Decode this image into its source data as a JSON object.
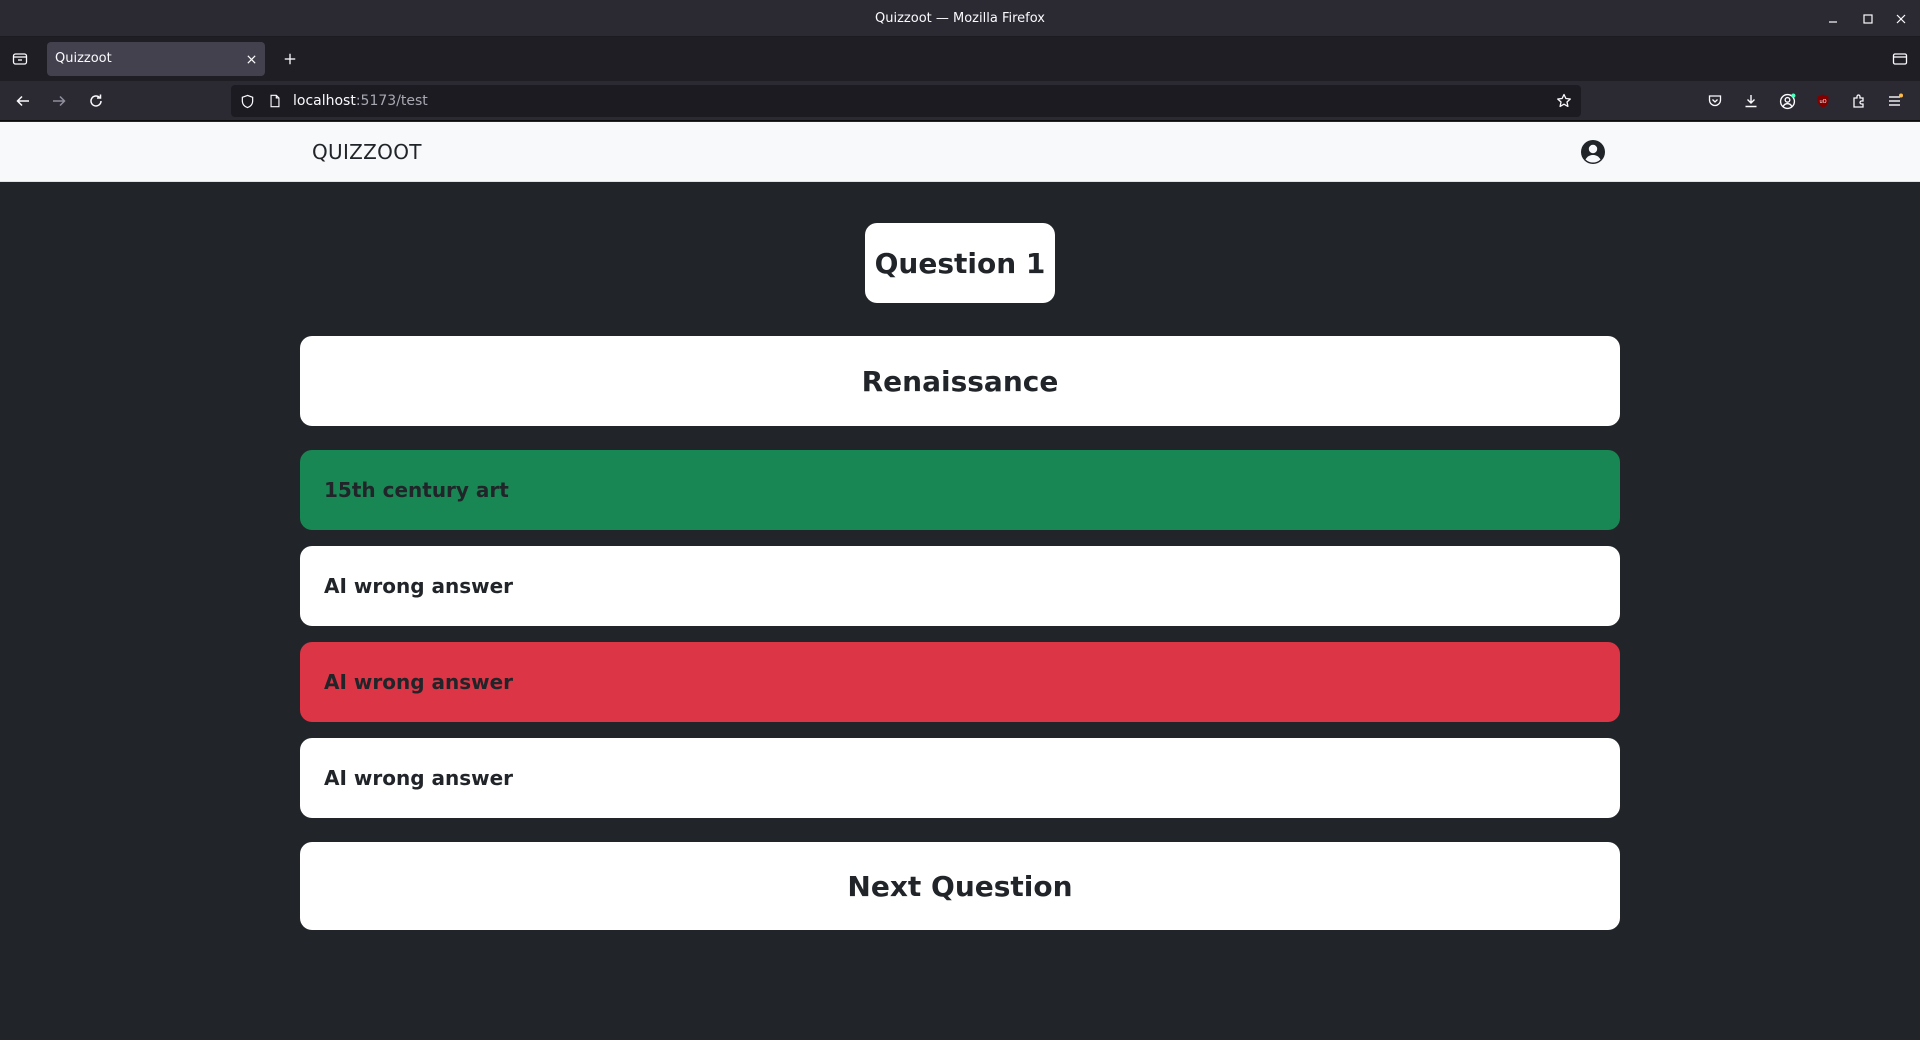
{
  "window": {
    "title": "Quizzoot — Mozilla Firefox"
  },
  "tab": {
    "label": "Quizzoot"
  },
  "url": {
    "host": "localhost",
    "path": ":5173/test"
  },
  "app": {
    "brand": "QUIZZOOT"
  },
  "quiz": {
    "question_label": "Question 1",
    "term": "Renaissance",
    "answers": [
      {
        "text": "15th century art",
        "state": "correct",
        "color": "#198754"
      },
      {
        "text": "AI wrong answer",
        "state": "default",
        "color": "#ffffff"
      },
      {
        "text": "AI wrong answer",
        "state": "wrong",
        "color": "#dc3545"
      },
      {
        "text": "AI wrong answer",
        "state": "default",
        "color": "#ffffff"
      }
    ],
    "next_label": "Next Question"
  },
  "colors": {
    "page_background": "#212529",
    "card": "#ffffff",
    "correct": "#198754",
    "wrong": "#dc3545"
  }
}
